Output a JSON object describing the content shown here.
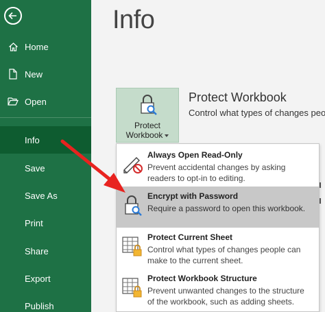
{
  "page": {
    "title": "Info"
  },
  "sidebar": {
    "items": [
      {
        "label": "Home",
        "icon": "home-icon"
      },
      {
        "label": "New",
        "icon": "new-document-icon"
      },
      {
        "label": "Open",
        "icon": "folder-open-icon"
      },
      {
        "label": "Info"
      },
      {
        "label": "Save"
      },
      {
        "label": "Save As"
      },
      {
        "label": "Print"
      },
      {
        "label": "Share"
      },
      {
        "label": "Export"
      },
      {
        "label": "Publish"
      }
    ],
    "selected": "Info"
  },
  "protect_workbook": {
    "button_line1": "Protect",
    "button_line2": "Workbook",
    "title": "Protect Workbook",
    "description": "Control what types of changes people"
  },
  "menu": {
    "items": [
      {
        "title": "Always Open Read-Only",
        "description": "Prevent accidental changes by asking readers to opt-in to editing.",
        "icon": "pencil-no-icon"
      },
      {
        "title": "Encrypt with Password",
        "description": "Require a password to open this workbook.",
        "icon": "lock-key-icon"
      },
      {
        "title": "Protect Current Sheet",
        "description": "Control what types of changes people can make to the current sheet.",
        "icon": "sheet-lock-icon"
      },
      {
        "title": "Protect Workbook Structure",
        "description": "Prevent unwanted changes to the structure of the workbook, such as adding sheets.",
        "icon": "workbook-lock-icon"
      }
    ],
    "highlighted": "Encrypt with Password"
  },
  "colors": {
    "sidebar_bg": "#1e7145",
    "sidebar_selected": "#0e5c30",
    "highlight": "#c8c8c8",
    "arrow": "#e8231f"
  }
}
